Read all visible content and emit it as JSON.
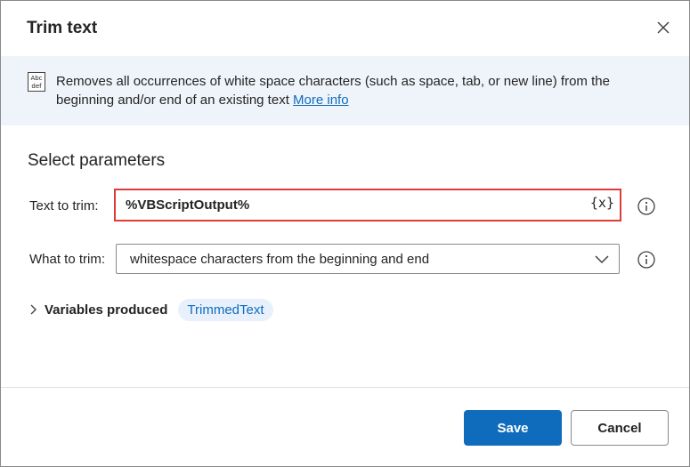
{
  "dialog": {
    "title": "Trim text"
  },
  "info": {
    "icon_text_top": "Abc",
    "icon_text_bottom": "def",
    "description": "Removes all occurrences of white space characters (such as space, tab, or new line) from the beginning and/or end of an existing text",
    "more_info_label": "More info"
  },
  "parameters": {
    "section_title": "Select parameters",
    "text_to_trim": {
      "label": "Text to trim:",
      "value": "%VBScriptOutput%",
      "variable_button": "{x}"
    },
    "what_to_trim": {
      "label": "What to trim:",
      "selected": "whitespace characters from the beginning and end"
    }
  },
  "variables": {
    "label": "Variables produced",
    "items": [
      "TrimmedText"
    ]
  },
  "footer": {
    "save_label": "Save",
    "cancel_label": "Cancel"
  },
  "colors": {
    "accent": "#0f6cbd",
    "highlight_border": "#e03b3b",
    "banner_background": "#eff4fb"
  }
}
